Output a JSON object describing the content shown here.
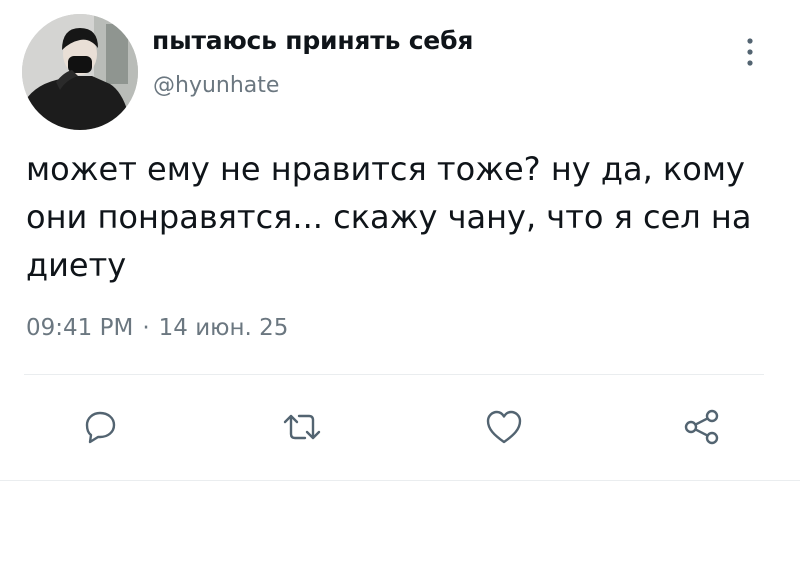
{
  "tweet": {
    "display_name": "пытаюсь принять себя",
    "username": "@hyunhate",
    "text": "может ему не нравится тоже? ну да, кому они понравятся... скажу чану, что я сел на диету",
    "time": "09:41 PM",
    "separator": "·",
    "date": "14 июн. 25"
  },
  "icons": {
    "more": "more-vertical-icon",
    "reply": "reply-bubble-icon",
    "retweet": "retweet-icon",
    "like": "heart-icon",
    "share": "share-icon"
  },
  "colors": {
    "text": "#0f1419",
    "secondary": "#6b7780",
    "icon": "#536471",
    "divider": "#eaedef"
  }
}
